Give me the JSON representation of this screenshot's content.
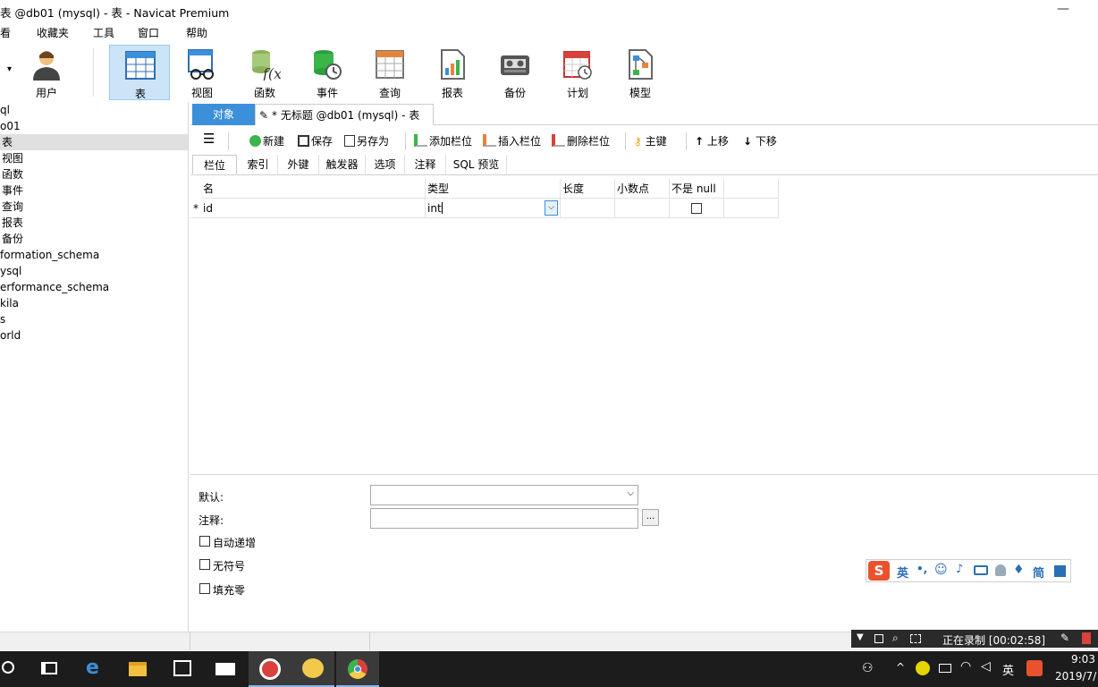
{
  "window": {
    "title": "表 @db01 (mysql) - 表 - Navicat Premium",
    "minimize": "—"
  },
  "menu": [
    "看",
    "收藏夹",
    "工具",
    "窗口",
    "帮助"
  ],
  "toolbar": {
    "dropdown_arrow": "▾",
    "items": [
      {
        "label": "用户",
        "icon": "user-icon"
      },
      {
        "label": "表",
        "icon": "table-icon",
        "active": true
      },
      {
        "label": "视图",
        "icon": "view-icon"
      },
      {
        "label": "函数",
        "icon": "function-icon"
      },
      {
        "label": "事件",
        "icon": "event-icon"
      },
      {
        "label": "查询",
        "icon": "query-icon"
      },
      {
        "label": "报表",
        "icon": "report-icon"
      },
      {
        "label": "备份",
        "icon": "backup-icon"
      },
      {
        "label": "计划",
        "icon": "schedule-icon"
      },
      {
        "label": "模型",
        "icon": "model-icon"
      }
    ]
  },
  "tree": {
    "nodes": [
      {
        "label": "ql"
      },
      {
        "label": "o01"
      },
      {
        "label": "表",
        "selected": true
      },
      {
        "label": "视图"
      },
      {
        "label": "函数"
      },
      {
        "label": "事件"
      },
      {
        "label": "查询"
      },
      {
        "label": "报表"
      },
      {
        "label": "备份"
      },
      {
        "label": "formation_schema"
      },
      {
        "label": "ysql"
      },
      {
        "label": "erformance_schema"
      },
      {
        "label": "kila"
      },
      {
        "label": "s"
      },
      {
        "label": "orld"
      }
    ]
  },
  "tabs": {
    "objects": "对象",
    "current": "* 无标题 @db01 (mysql) - 表"
  },
  "editor_toolbar": {
    "menu": "☰",
    "new": "新建",
    "save": "保存",
    "save_as": "另存为",
    "add_field": "添加栏位",
    "insert_field": "插入栏位",
    "delete_field": "删除栏位",
    "primary_key": "主键",
    "move_up": "上移",
    "move_down": "下移"
  },
  "subtabs": [
    "栏位",
    "索引",
    "外键",
    "触发器",
    "选项",
    "注释",
    "SQL 预览"
  ],
  "grid": {
    "headers": {
      "name": "名",
      "type": "类型",
      "length": "长度",
      "decimals": "小数点",
      "not_null": "不是 null"
    },
    "rows": [
      {
        "marker": "*",
        "name": "id",
        "type": "int",
        "length": "",
        "decimals": "",
        "not_null": false
      }
    ]
  },
  "props": {
    "default_label": "默认:",
    "comment_label": "注释:",
    "browse_button": "...",
    "auto_increment": "自动递增",
    "unsigned": "无符号",
    "zerofill": "填充零"
  },
  "recorder": {
    "status": "正在录制 [00:02:58]"
  },
  "ime": {
    "lang": "英",
    "punct": "•,",
    "simplified": "简"
  },
  "taskbar": {
    "lang": "英",
    "time": "9:03",
    "date": "2019/7/"
  }
}
